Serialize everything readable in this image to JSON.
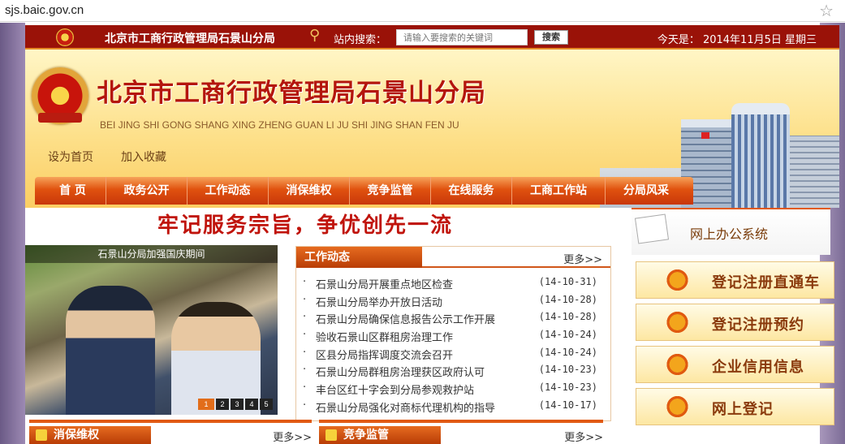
{
  "browser": {
    "url": "sjs.baic.gov.cn"
  },
  "topbar": {
    "site_name": "北京市工商行政管理局石景山分局",
    "search_label": "站内搜索：",
    "search_placeholder": "请输入要搜索的关键词",
    "search_button": "搜索",
    "date": "今天是： 2014年11月5日 星期三"
  },
  "header": {
    "title": "北京市工商行政管理局石景山分局",
    "pinyin": "BEI JING SHI GONG SHANG XING ZHENG GUAN LI JU SHI JING SHAN FEN JU",
    "set_home": "设为首页",
    "add_favorite": "加入收藏"
  },
  "nav": {
    "items": [
      "首 页",
      "政务公开",
      "工作动态",
      "消保维权",
      "竞争监管",
      "在线服务",
      "工商工作站",
      "分局风采"
    ]
  },
  "slogan": "牢记服务宗旨，争优创先一流",
  "photo": {
    "caption": "石景山分局加强国庆期间",
    "pages": [
      "1",
      "2",
      "3",
      "4",
      "5"
    ]
  },
  "news": {
    "tab": "工作动态",
    "more": "更多>>",
    "items": [
      {
        "title": "石景山分局开展重点地区检查",
        "date": "(14-10-31)"
      },
      {
        "title": "石景山分局举办开放日活动",
        "date": "(14-10-28)"
      },
      {
        "title": "石景山分局确保信息报告公示工作开展",
        "date": "(14-10-28)"
      },
      {
        "title": "验收石景山区群租房治理工作",
        "date": "(14-10-24)"
      },
      {
        "title": "区县分局指挥调度交流会召开",
        "date": "(14-10-24)"
      },
      {
        "title": "石景山分局群租房治理获区政府认可",
        "date": "(14-10-23)"
      },
      {
        "title": "丰台区红十字会到分局参观救护站",
        "date": "(14-10-23)"
      },
      {
        "title": "石景山分局强化对商标代理机构的指导",
        "date": "(14-10-17)"
      }
    ]
  },
  "bottom": {
    "left_tab": "消保维权",
    "left_more": "更多>>",
    "right_tab": "竞争监管",
    "right_more": "更多>>"
  },
  "right": {
    "online_system": "网上办公系统",
    "buttons": [
      "登记注册直通车",
      "登记注册预约",
      "企业信用信息",
      "网上登记"
    ]
  },
  "colors": {
    "primary_red": "#9a1208",
    "accent_orange": "#e15a13",
    "title_red": "#b4160d"
  }
}
